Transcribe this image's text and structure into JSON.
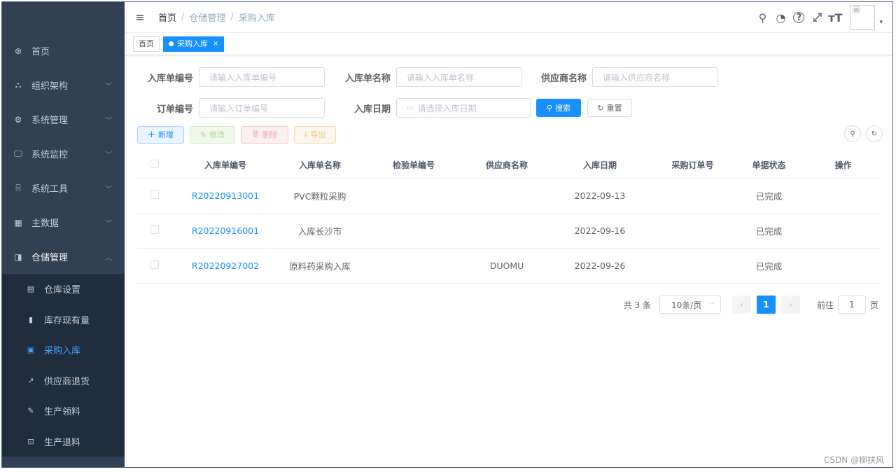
{
  "sidebar": {
    "items": [
      {
        "label": "首页",
        "icon": "dashboard-icon",
        "glyph": "⊛",
        "chevron": ""
      },
      {
        "label": "组织架构",
        "icon": "tree-icon",
        "glyph": "⛬",
        "chevron": "﹀"
      },
      {
        "label": "系统管理",
        "icon": "gear-icon",
        "glyph": "⚙",
        "chevron": "﹀"
      },
      {
        "label": "系统监控",
        "icon": "monitor-icon",
        "glyph": "🖵",
        "chevron": "﹀"
      },
      {
        "label": "系统工具",
        "icon": "toolbox-icon",
        "glyph": "⌸",
        "chevron": "﹀"
      },
      {
        "label": "主数据",
        "icon": "grid-icon",
        "glyph": "▦",
        "chevron": "﹀"
      },
      {
        "label": "仓储管理",
        "icon": "warehouse-icon",
        "glyph": "◨",
        "chevron": "︿"
      }
    ],
    "subitems": [
      {
        "label": "仓库设置",
        "icon": "building-icon",
        "glyph": "▤"
      },
      {
        "label": "库存现有量",
        "icon": "bar-chart-icon",
        "glyph": "▮"
      },
      {
        "label": "采购入库",
        "icon": "inbound-icon",
        "glyph": "▣",
        "active": true
      },
      {
        "label": "供应商退货",
        "icon": "external-link-icon",
        "glyph": "↗"
      },
      {
        "label": "生产领料",
        "icon": "edit-icon",
        "glyph": "✎"
      },
      {
        "label": "生产退料",
        "icon": "return-icon",
        "glyph": "⊡"
      }
    ]
  },
  "navbar": {
    "breadcrumb": [
      "首页",
      "仓储管理",
      "采购入库"
    ],
    "separator": "/",
    "hamburger": "≡",
    "avatar_alt": "🖼",
    "caret": "▾",
    "icons": [
      {
        "name": "search-icon",
        "glyph": "⚲"
      },
      {
        "name": "github-icon",
        "glyph": "◔"
      },
      {
        "name": "help-icon",
        "glyph": "?"
      },
      {
        "name": "fullscreen-icon",
        "glyph": "⤢"
      },
      {
        "name": "font-size-icon",
        "glyph": "тT"
      }
    ]
  },
  "tags": [
    {
      "label": "首页",
      "active": false
    },
    {
      "label": "采购入库",
      "active": true,
      "close": "×"
    }
  ],
  "search": {
    "fields": [
      {
        "label": "入库单编号",
        "placeholder": "请输入入库单编号"
      },
      {
        "label": "入库单名称",
        "placeholder": "请输入入库单名称"
      },
      {
        "label": "供应商名称",
        "placeholder": "请输入供应商名称"
      },
      {
        "label": "订单编号",
        "placeholder": "请输入订单编号"
      },
      {
        "label": "入库日期",
        "placeholder": "请选择入库日期"
      }
    ],
    "calendar_glyph": "▭",
    "search_button": "搜索",
    "search_glyph": "⚲",
    "reset_button": "重置",
    "reset_glyph": "↻"
  },
  "toolbar": {
    "add": "新增",
    "add_glyph": "+",
    "edit": "修改",
    "edit_glyph": "✎",
    "delete": "删除",
    "delete_glyph": "🗑",
    "export": "导出",
    "export_glyph": "⤓",
    "search_circle_glyph": "⚲",
    "refresh_circle_glyph": "↻"
  },
  "table": {
    "columns": [
      "入库单编号",
      "入库单名称",
      "检验单编号",
      "供应商名称",
      "入库日期",
      "采购订单号",
      "单据状态",
      "操作"
    ],
    "rows": [
      [
        "R20220913001",
        "PVC颗粒采购",
        "",
        "",
        "2022-09-13",
        "",
        "已完成",
        ""
      ],
      [
        "R20220916001",
        "入库长沙市",
        "",
        "",
        "2022-09-16",
        "",
        "已完成",
        ""
      ],
      [
        "R20220927002",
        "原料药采购入库",
        "",
        "DUOMU",
        "2022-09-26",
        "",
        "已完成",
        ""
      ]
    ]
  },
  "pagination": {
    "total": "共 3 条",
    "page_size": "10条/页",
    "size_caret": "﹀",
    "prev": "‹",
    "next": "›",
    "current": "1",
    "goto_label": "前往",
    "goto_value": "1",
    "goto_suffix": "页"
  },
  "watermark": "CSDN @柳扶风"
}
